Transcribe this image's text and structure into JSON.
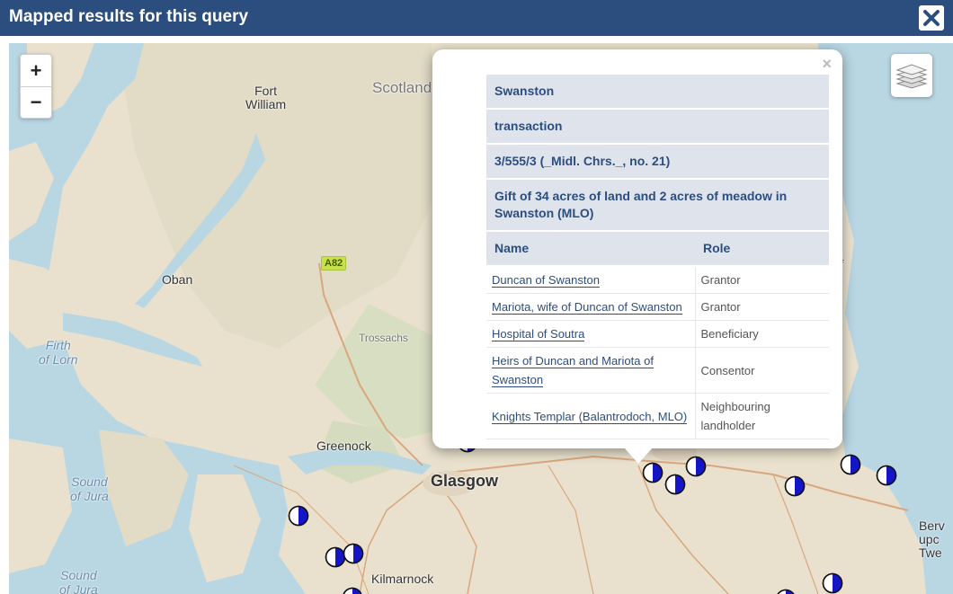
{
  "header": {
    "title": "Mapped results for this query",
    "close_icon": "close-icon"
  },
  "map": {
    "zoom_in": "+",
    "zoom_out": "−",
    "layers_icon": "layers-icon",
    "labels": {
      "fort_william": "Fort\nWilliam",
      "scotland": "Scotland",
      "oban": "Oban",
      "firth_of_lorn": "Firth\nof Lorn",
      "trossachs": "Trossachs",
      "a82": "A82",
      "greenock": "Greenock",
      "glasgow": "Glasgow",
      "sound_of_jura_1": "Sound\nof Jura",
      "sound_of_jura_2": "Sound\nof Jura",
      "kilmarnock": "Kilmarnock",
      "berwick": "Berv\nupc\nTwe",
      "f_partial": "f"
    },
    "marker_color": "#1515c8"
  },
  "popup": {
    "close": "×",
    "place": "Swanston",
    "type": "transaction",
    "reference": "3/555/3 (_Midl. Chrs._, no. 21)",
    "description": "Gift of 34 acres of land and 2 acres of meadow in Swanston (MLO)",
    "columns": {
      "name": "Name",
      "role": "Role"
    },
    "rows": [
      {
        "name": "Duncan of Swanston",
        "role": "Grantor"
      },
      {
        "name": "Mariota, wife of Duncan of Swanston",
        "role": "Grantor"
      },
      {
        "name": "Hospital of Soutra",
        "role": "Beneficiary"
      },
      {
        "name": "Heirs of Duncan and Mariota of Swanston",
        "role": "Consentor"
      },
      {
        "name": "Knights Templar (Balantrodoch, MLO)",
        "role": "Neighbouring landholder"
      }
    ]
  }
}
